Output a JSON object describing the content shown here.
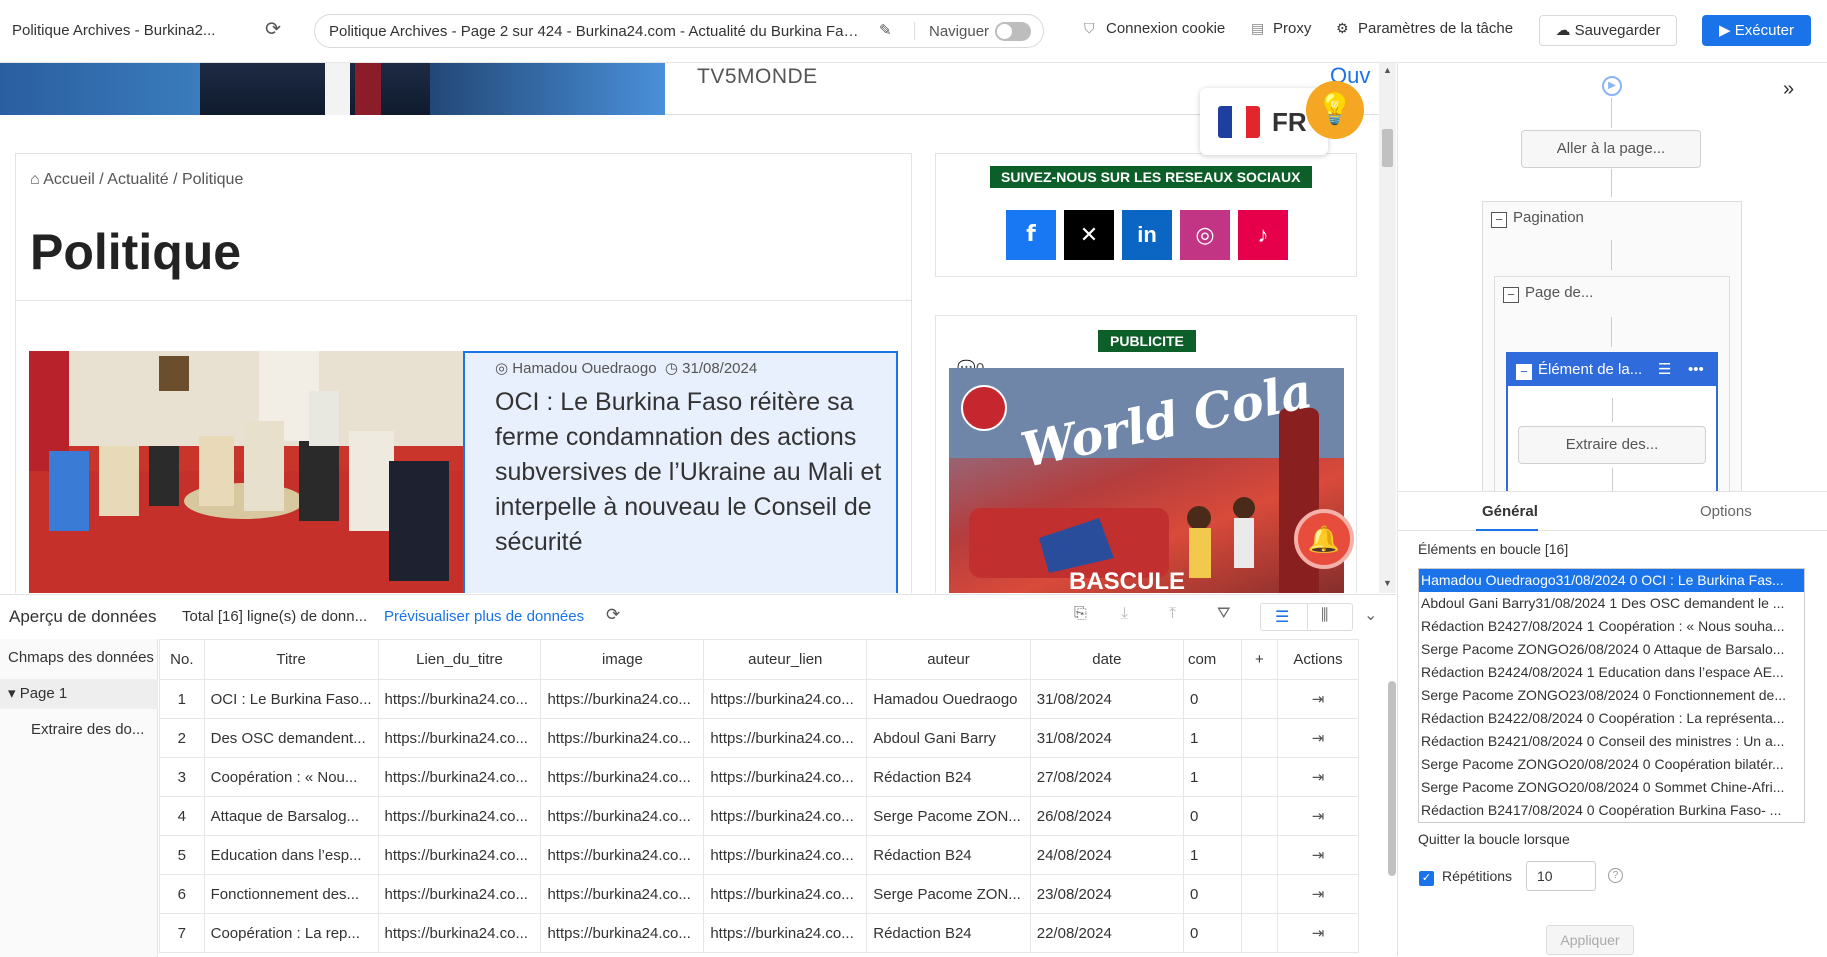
{
  "topbar": {
    "tab_title": "Politique Archives - Burkina2...",
    "url": "Politique Archives - Page 2 sur 424 - Burkina24.com - Actualité du Burkina Faso...",
    "navigate_label": "Naviguer",
    "cookie_label": "Connexion cookie",
    "proxy_label": "Proxy",
    "task_settings_label": "Paramètres de la tâche",
    "save_label": "Sauvegarder",
    "run_label": "Exécuter"
  },
  "webpage": {
    "banner_text": "TV5MONDE",
    "banner_link": "Ouv",
    "lang": "FR",
    "breadcrumb": "Accueil / Actualité / Politique",
    "page_title": "Politique",
    "article": {
      "author": "Hamadou Ouedraogo",
      "date": "31/08/2024",
      "comments": "0",
      "title": "OCI : Le Burkina Faso réitère sa ferme condamnation des actions subversives de l’Ukraine au Mali et interpelle à nouveau le Conseil de sécurité"
    },
    "social_header": "SUIVEZ-NOUS SUR LES RESEAUX SOCIAUX",
    "ad_header": "PUBLICITE",
    "ad_text": "World Cola",
    "ad_subtext": "BASCULE"
  },
  "workflow": {
    "goto_page": "Aller à la page...",
    "pagination": "Pagination",
    "page_de": "Page de...",
    "loop_element": "Élément de la...",
    "extract": "Extraire des..."
  },
  "props": {
    "tab_general": "Général",
    "tab_options": "Options",
    "loop_items_label": "Éléments en boucle [16]",
    "loop_items": [
      "Hamadou Ouedraogo31/08/2024 0 OCI : Le Burkina Fas...",
      "Abdoul Gani Barry31/08/2024 1 Des OSC demandent le ...",
      "Rédaction B2427/08/2024 1 Coopération : « Nous souha...",
      "Serge Pacome ZONGO26/08/2024 0 Attaque de Barsalo...",
      "Rédaction B2424/08/2024 1 Education dans l’espace AE...",
      "Serge Pacome ZONGO23/08/2024 0 Fonctionnement de...",
      "Rédaction B2422/08/2024 0 Coopération : La représenta...",
      "Rédaction B2421/08/2024 0 Conseil des ministres : Un a...",
      "Serge Pacome ZONGO20/08/2024 0 Coopération bilatér...",
      "Serge Pacome ZONGO20/08/2024 0 Sommet Chine-Afri...",
      "Rédaction B2417/08/2024 0 Coopération Burkina Faso- ..."
    ],
    "quit_label": "Quitter la boucle lorsque",
    "repetitions_label": "Répétitions",
    "repetitions_value": "10",
    "apply_label": "Appliquer"
  },
  "datapanel": {
    "title": "Aperçu de données",
    "total": "Total [16] ligne(s) de donn...",
    "preview_more": "Prévisualiser plus de données",
    "side_header": "Chmaps des données",
    "page_item": "Page 1",
    "extract_item": "Extraire des do...",
    "columns": [
      "No.",
      "Titre",
      "Lien_du_titre",
      "image",
      "auteur_lien",
      "auteur",
      "date",
      "com",
      "+",
      "Actions"
    ],
    "rows": [
      [
        "1",
        "OCI : Le Burkina Faso...",
        "https://burkina24.co...",
        "https://burkina24.co...",
        "https://burkina24.co...",
        "Hamadou Ouedraogo",
        "31/08/2024",
        "0"
      ],
      [
        "2",
        "Des OSC demandent...",
        "https://burkina24.co...",
        "https://burkina24.co...",
        "https://burkina24.co...",
        "Abdoul Gani Barry",
        "31/08/2024",
        "1"
      ],
      [
        "3",
        "Coopération : « Nou...",
        "https://burkina24.co...",
        "https://burkina24.co...",
        "https://burkina24.co...",
        "Rédaction B24",
        "27/08/2024",
        "1"
      ],
      [
        "4",
        "Attaque de Barsalog...",
        "https://burkina24.co...",
        "https://burkina24.co...",
        "https://burkina24.co...",
        "Serge Pacome ZON...",
        "26/08/2024",
        "0"
      ],
      [
        "5",
        "Education dans l’esp...",
        "https://burkina24.co...",
        "https://burkina24.co...",
        "https://burkina24.co...",
        "Rédaction B24",
        "24/08/2024",
        "1"
      ],
      [
        "6",
        "Fonctionnement des...",
        "https://burkina24.co...",
        "https://burkina24.co...",
        "https://burkina24.co...",
        "Serge Pacome ZON...",
        "23/08/2024",
        "0"
      ],
      [
        "7",
        "Coopération : La rep...",
        "https://burkina24.co...",
        "https://burkina24.co...",
        "https://burkina24.co...",
        "Rédaction B24",
        "22/08/2024",
        "0"
      ]
    ]
  },
  "colors": {
    "accent": "#1a73e8",
    "social_header_bg": "#0d5f2a",
    "facebook": "#1877f2",
    "x": "#000000",
    "linkedin": "#0a66c2",
    "instagram": "#c13584",
    "tiktok": "#e6004c"
  }
}
